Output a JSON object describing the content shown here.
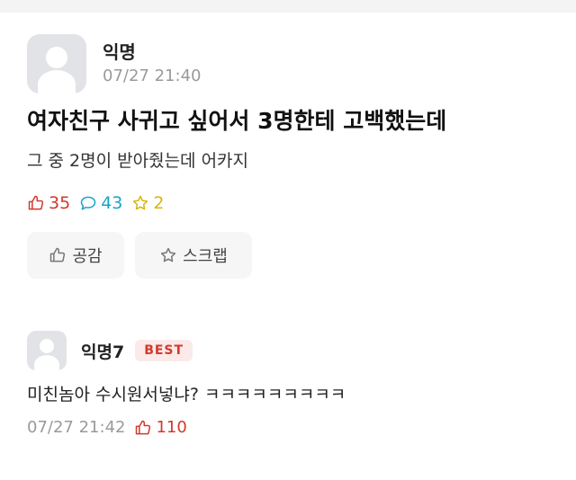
{
  "post": {
    "author": "익명",
    "timestamp": "07/27 21:40",
    "title": "여자친구 사귀고 싶어서 3명한테 고백했는데",
    "body": "그 중 2명이 받아줬는데 어카지",
    "stats": {
      "likes": "35",
      "comments": "43",
      "scraps": "2"
    },
    "actions": {
      "like_label": "공감",
      "scrap_label": "스크랩"
    }
  },
  "comment": {
    "author": "익명7",
    "badge": "BEST",
    "text": "미친놈아 수시원서넣냐? ㅋㅋㅋㅋㅋㅋㅋㅋㅋ",
    "timestamp": "07/27 21:42",
    "likes": "110"
  },
  "colors": {
    "like": "#d13a2c",
    "comment": "#1aa3c8",
    "scrap": "#d9b40e",
    "muted": "#9a9a9a"
  },
  "icons": [
    "avatar-placeholder",
    "thumbs-up-icon",
    "speech-bubble-icon",
    "star-icon"
  ]
}
